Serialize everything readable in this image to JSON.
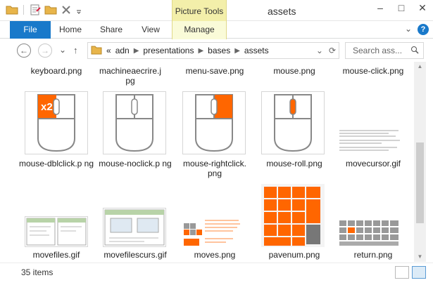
{
  "window": {
    "title": "assets",
    "context_tab_group": "Picture Tools"
  },
  "ribbon": {
    "tabs": [
      "File",
      "Home",
      "Share",
      "View",
      "Manage"
    ]
  },
  "nav": {
    "breadcrumb": [
      "adn",
      "presentations",
      "bases",
      "assets"
    ],
    "overflow": "«",
    "search_placeholder": "Search ass..."
  },
  "files": {
    "row1": [
      "keyboard.png",
      "machineaecrire.j pg",
      "menu-save.png",
      "mouse.png",
      "mouse-click.png"
    ],
    "row2": [
      "mouse-dblclick.p ng",
      "mouse-noclick.p ng",
      "mouse-rightclick. png",
      "mouse-roll.png",
      "movecursor.gif"
    ],
    "row3": [
      "movefiles.gif",
      "movefilescurs.gif",
      "moves.png",
      "pavenum.png",
      "return.png"
    ],
    "dblclick_badge": "x2"
  },
  "status": {
    "count": "35 items"
  },
  "colors": {
    "accent": "#1979ca",
    "orange": "#ff6600",
    "context": "#f3efaa"
  }
}
